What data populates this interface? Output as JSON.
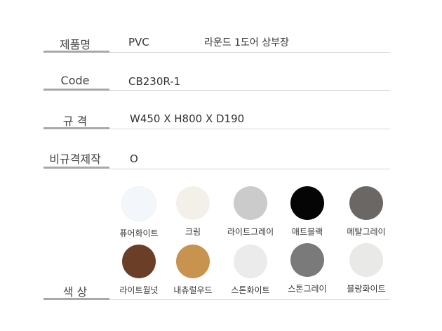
{
  "product": {
    "name_label": "제품명",
    "name_value_1": "PVC",
    "name_value_2": "라운드 1도어 상부장",
    "code_label": "Code",
    "code_value": "CB230R-1",
    "size_label": "규 격",
    "size_value": "W450 X H800 X D190",
    "custom_label": "비규격제작",
    "custom_value": "O",
    "color_label": "색 상"
  },
  "colors": [
    {
      "name": "퓨어화이트",
      "hex": "#f3f6fa"
    },
    {
      "name": "크림",
      "hex": "#f3f0ea"
    },
    {
      "name": "라이트그레이",
      "hex": "#cbcbcb"
    },
    {
      "name": "매트블랙",
      "hex": "#050505"
    },
    {
      "name": "메탈그레이",
      "hex": "#6b6764"
    },
    {
      "name": "라이트월넛",
      "hex": "#6b3f27"
    },
    {
      "name": "내츄럴우드",
      "hex": "#c8924f"
    },
    {
      "name": "스톤화이트",
      "hex": "#ebebeb"
    },
    {
      "name": "스톤그레이",
      "hex": "#7a7a7a"
    },
    {
      "name": "블랑화이트",
      "hex": "#e9e9e7"
    }
  ]
}
